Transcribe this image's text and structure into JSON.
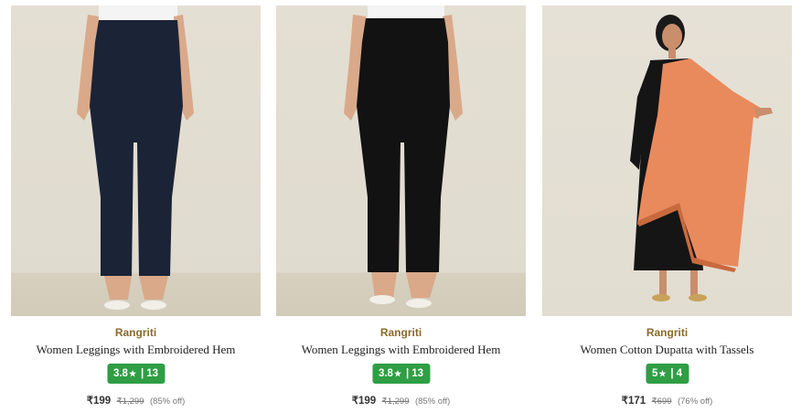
{
  "products": [
    {
      "image": "product-photo-navy-leggings",
      "garment_color": "#1b2336",
      "brand": "Rangriti",
      "title": "Women Leggings with Embroidered Hem",
      "rating": "3.8",
      "star_icon": "★",
      "rating_count": "13",
      "price": "₹199",
      "mrp": "₹1,299",
      "discount": "(85% off)"
    },
    {
      "image": "product-photo-black-leggings",
      "garment_color": "#121212",
      "brand": "Rangriti",
      "title": "Women Leggings with Embroidered Hem",
      "rating": "3.8",
      "star_icon": "★",
      "rating_count": "13",
      "price": "₹199",
      "mrp": "₹1,299",
      "discount": "(85% off)"
    },
    {
      "image": "product-photo-orange-dupatta",
      "garment_color": "#e98a5d",
      "brand": "Rangriti",
      "title": "Women Cotton Dupatta with Tassels",
      "rating": "5",
      "star_icon": "★",
      "rating_count": "4",
      "price": "₹171",
      "mrp": "₹699",
      "discount": "(76% off)"
    }
  ],
  "colors": {
    "rating_badge": "#2f9e44",
    "brand_text": "#8a6a2c",
    "background": "#ffffff"
  }
}
